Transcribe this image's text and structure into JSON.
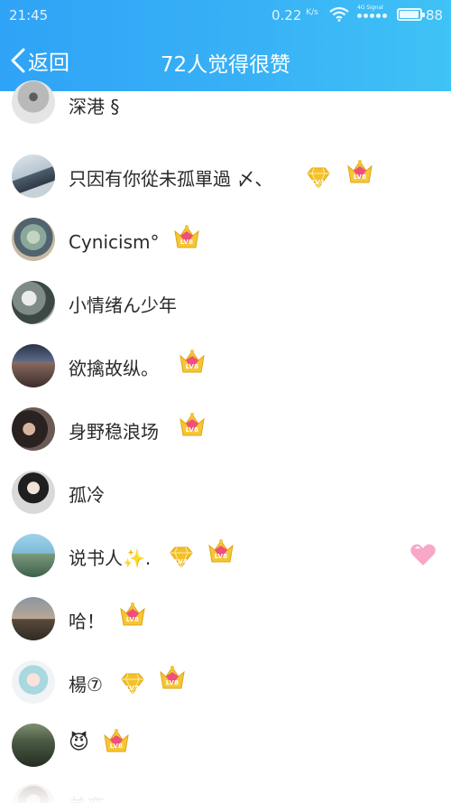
{
  "status_bar": {
    "time": "21:45",
    "speed": "0.22",
    "speed_unit": "K/s",
    "network_label": "4G Signal",
    "battery": "88"
  },
  "nav": {
    "back_label": "返回",
    "title": "72人觉得很赞"
  },
  "colors": {
    "header_gradient_start": "#2fa3f6",
    "header_gradient_end": "#3fc2f5",
    "text": "#2a2a2a",
    "badge_gold": "#f5c02a",
    "badge_pink": "#ee4f7c"
  },
  "likers": [
    {
      "name": "深港 §",
      "badges": []
    },
    {
      "name": "只因有你從未孤單過 〆、",
      "badges": [
        "LV1",
        "LV8"
      ]
    },
    {
      "name": "Cynicism°",
      "badges": [
        "LV8"
      ]
    },
    {
      "name": "小情绪ん少年",
      "badges": []
    },
    {
      "name": "欲擒故纵。",
      "badges": [
        "LV8"
      ]
    },
    {
      "name": "身野稳浪场",
      "badges": [
        "LV8"
      ]
    },
    {
      "name": "孤冷",
      "badges": []
    },
    {
      "name": "说书人",
      "emoji": "✨",
      "suffix": ".",
      "badges": [
        "LV4",
        "LV8"
      ],
      "has_heart": true
    },
    {
      "name": "哈！",
      "badges": [
        "LV8"
      ]
    },
    {
      "name": "楊⑦",
      "badges": [
        "LV7",
        "LV8"
      ]
    },
    {
      "name": "",
      "emoji": "😈",
      "badges": [
        "LV8"
      ]
    },
    {
      "name": "美恋",
      "badges": []
    }
  ]
}
